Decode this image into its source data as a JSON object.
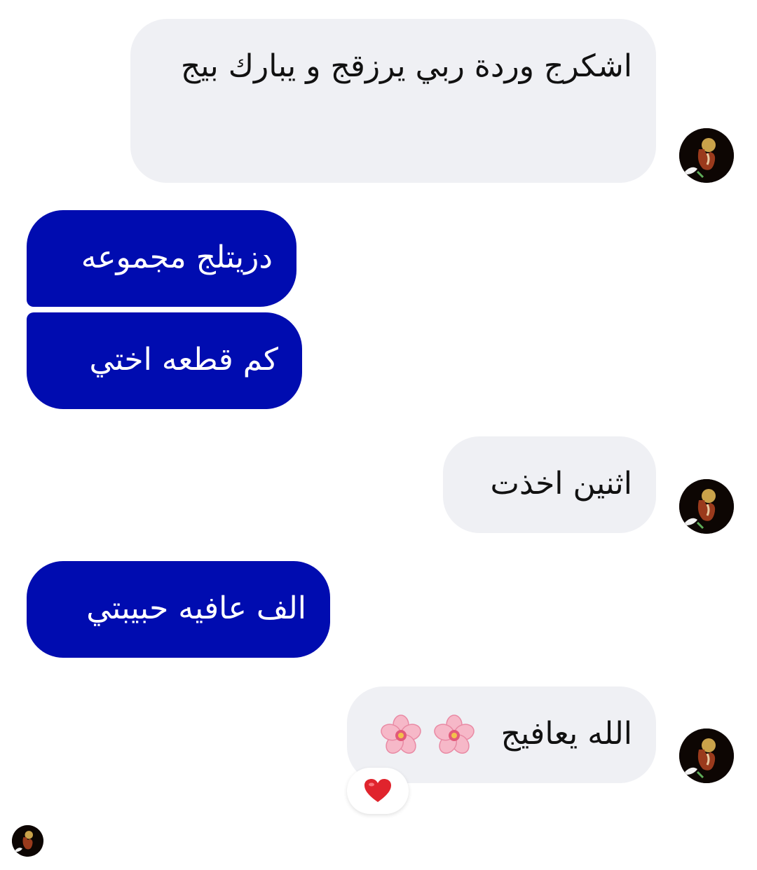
{
  "messages": [
    {
      "from": "other",
      "text": "اشكرج وردة  ربي يرزقج و  يبارك بيج"
    },
    {
      "from": "me",
      "text": "دزيتلج مجموعه"
    },
    {
      "from": "me",
      "text": "كم قطعه اختي"
    },
    {
      "from": "other",
      "text": "اثنين اخذت"
    },
    {
      "from": "me",
      "text": "الف عافيه حبيبتي"
    },
    {
      "from": "other",
      "text": "الله يعافيج",
      "emoji": "🌸🌸",
      "reaction": "heart-emoji"
    }
  ],
  "colors": {
    "outgoing_bubble": "#000cb0",
    "incoming_bubble": "#eff0f4",
    "reaction_heart": "#e0242d"
  },
  "icons": [
    "avatar",
    "cherry-blossom-emoji",
    "heart-emoji"
  ]
}
